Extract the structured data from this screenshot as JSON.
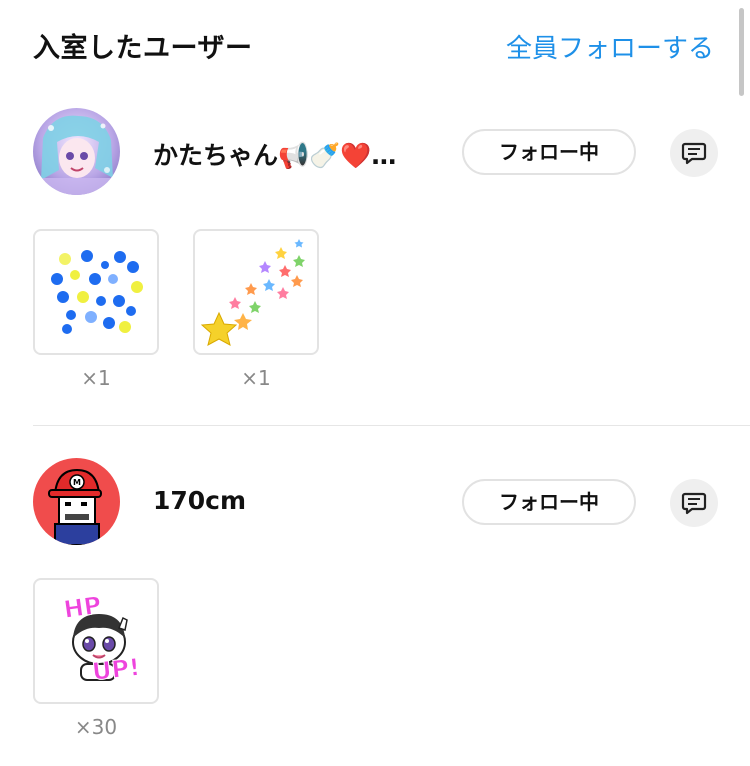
{
  "header": {
    "title": "入室したユーザー",
    "follow_all_label": "全員フォローする"
  },
  "users": [
    {
      "name": "かたちゃん📢🍼❤️…",
      "follow_label": "フォロー中",
      "gifts": [
        {
          "icon": "sparkle-dots-icon",
          "count": "×1"
        },
        {
          "icon": "shooting-star-icon",
          "count": "×1"
        }
      ]
    },
    {
      "name": "170cm",
      "follow_label": "フォロー中",
      "gifts": [
        {
          "icon": "hp-up-sticker-icon",
          "count": "×30"
        }
      ]
    }
  ],
  "colors": {
    "accent": "#1e90e8",
    "avatar2_bg": "#f04c4c",
    "border": "#e2e2e2"
  }
}
